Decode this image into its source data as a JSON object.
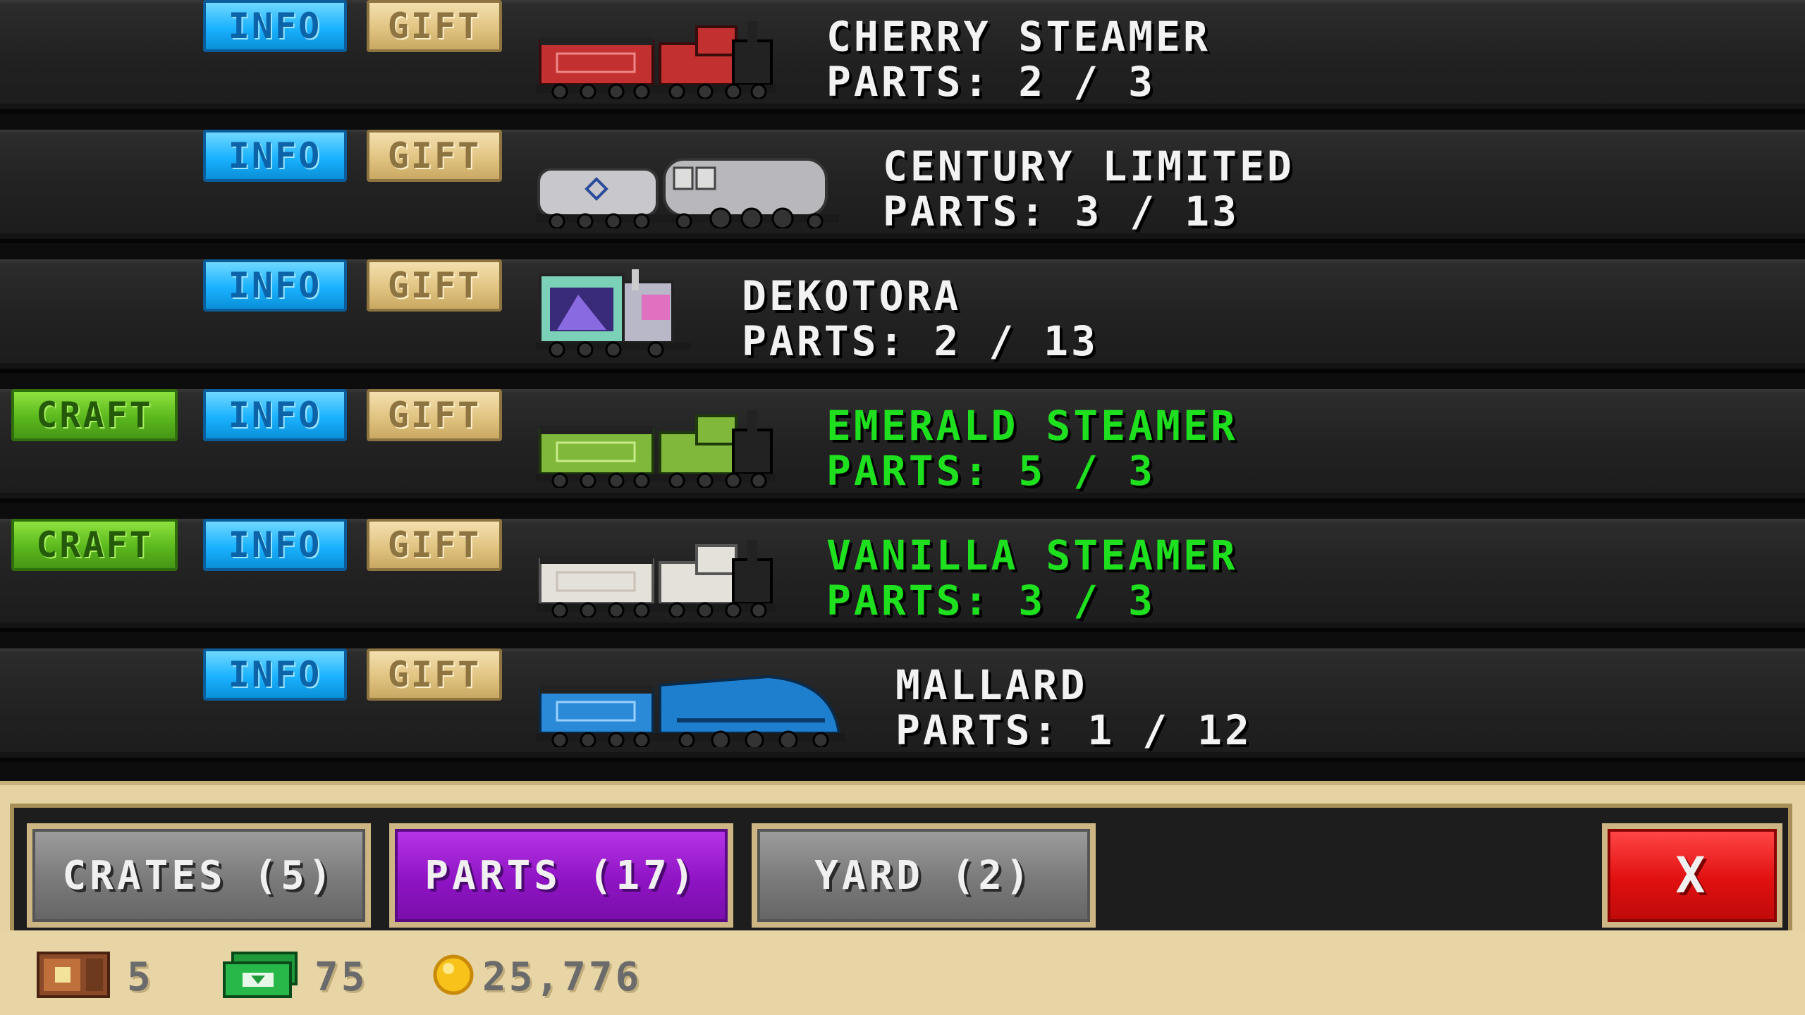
{
  "trains": [
    {
      "title": "CHERRY STEAMER",
      "parts": "PARTS: 2 / 3",
      "craft": "",
      "info": "INFO",
      "gift": "GIFT",
      "complete": false
    },
    {
      "title": "CENTURY LIMITED",
      "parts": "PARTS: 3 / 13",
      "craft": "",
      "info": "INFO",
      "gift": "GIFT",
      "complete": false
    },
    {
      "title": "DEKOTORA",
      "parts": "PARTS: 2 / 13",
      "craft": "",
      "info": "INFO",
      "gift": "GIFT",
      "complete": false
    },
    {
      "title": "EMERALD STEAMER",
      "parts": "PARTS: 5 / 3",
      "craft": "CRAFT",
      "info": "INFO",
      "gift": "GIFT",
      "complete": true
    },
    {
      "title": "VANILLA STEAMER",
      "parts": "PARTS: 3 / 3",
      "craft": "CRAFT",
      "info": "INFO",
      "gift": "GIFT",
      "complete": true
    },
    {
      "title": "MALLARD",
      "parts": "PARTS: 1 / 12",
      "craft": "",
      "info": "INFO",
      "gift": "GIFT",
      "complete": false
    }
  ],
  "tabs": {
    "crates": "CRATES (5)",
    "parts": "PARTS (17)",
    "yard": "YARD (2)",
    "close": "X"
  },
  "status": {
    "crates_count": "5",
    "cash": "75",
    "coins": "25,776"
  },
  "colors": {
    "craft": "#5bb81d",
    "info": "#1ab2ff",
    "gift": "#e1c482",
    "parts_tab": "#8f14c4",
    "close": "#e01010",
    "complete_text": "#1fe01f"
  },
  "icons": [
    "crate-icon",
    "cash-icon",
    "coin-icon",
    "close-icon"
  ]
}
